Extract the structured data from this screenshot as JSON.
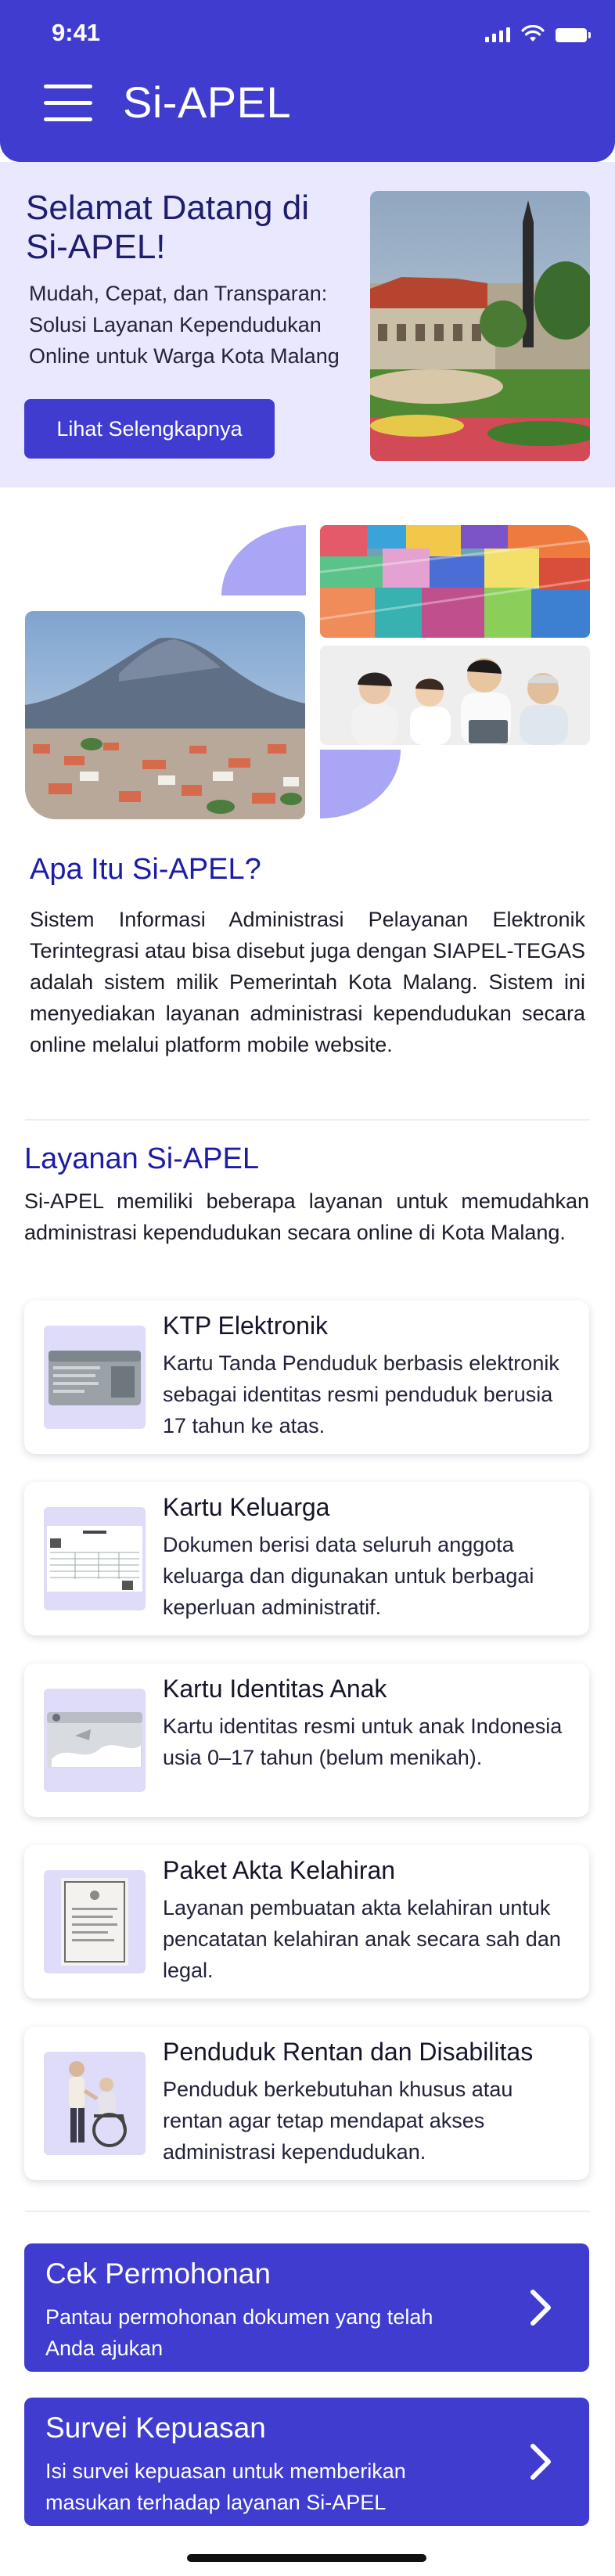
{
  "status_bar": {
    "time": "9:41"
  },
  "header": {
    "title": "Si-APEL"
  },
  "hero": {
    "title": "Selamat Datang di Si-APEL!",
    "subtitle": "Mudah, Cepat, dan Transparan: Solusi Layanan Kependudukan Online untuk Warga Kota Malang",
    "button_label": "Lihat Selengkapnya"
  },
  "about": {
    "title": "Apa Itu Si-APEL?",
    "body": "Sistem Informasi Administrasi Pelayanan Elektronik Terintegrasi atau bisa disebut juga dengan SIAPEL-TEGAS adalah sistem milik Pemerintah Kota Malang. Sistem ini menyediakan layanan administrasi kependudukan secara online melalui platform mobile website."
  },
  "services": {
    "title": "Layanan Si-APEL",
    "intro": "Si-APEL memiliki beberapa layanan untuk memudahkan administrasi kependudukan secara online di Kota Malang.",
    "items": [
      {
        "title": "KTP Elektronik",
        "desc": "Kartu Tanda Penduduk berbasis elektronik sebagai identitas resmi penduduk berusia 17 tahun ke atas.",
        "icon": "ktp-card-icon"
      },
      {
        "title": "Kartu Keluarga",
        "desc": "Dokumen berisi data seluruh anggota keluarga dan digunakan untuk berbagai keperluan administratif.",
        "icon": "family-card-icon"
      },
      {
        "title": "Kartu Identitas Anak",
        "desc": "Kartu identitas resmi untuk anak Indonesia usia 0–17 tahun (belum menikah).",
        "icon": "child-id-card-icon"
      },
      {
        "title": "Paket Akta Kelahiran",
        "desc": "Layanan pembuatan akta kelahiran untuk pencatatan kelahiran anak secara sah dan legal.",
        "icon": "birth-certificate-icon"
      },
      {
        "title": "Penduduk Rentan dan Disabilitas",
        "desc": "Penduduk berkebutuhan khusus atau rentan agar tetap mendapat akses administrasi kependudukan.",
        "icon": "wheelchair-icon"
      }
    ]
  },
  "actions": [
    {
      "title": "Cek Permohonan",
      "desc": "Pantau permohonan dokumen yang telah Anda ajukan"
    },
    {
      "title": "Survei Kepuasan",
      "desc": "Isi survei kepuasan untuk memberikan masukan terhadap layanan Si-APEL"
    }
  ],
  "colors": {
    "primary": "#3f3ccf",
    "hero_bg": "#e9e8fe",
    "accent_shape": "#a9a7f5",
    "heading": "#1c1ca8"
  }
}
